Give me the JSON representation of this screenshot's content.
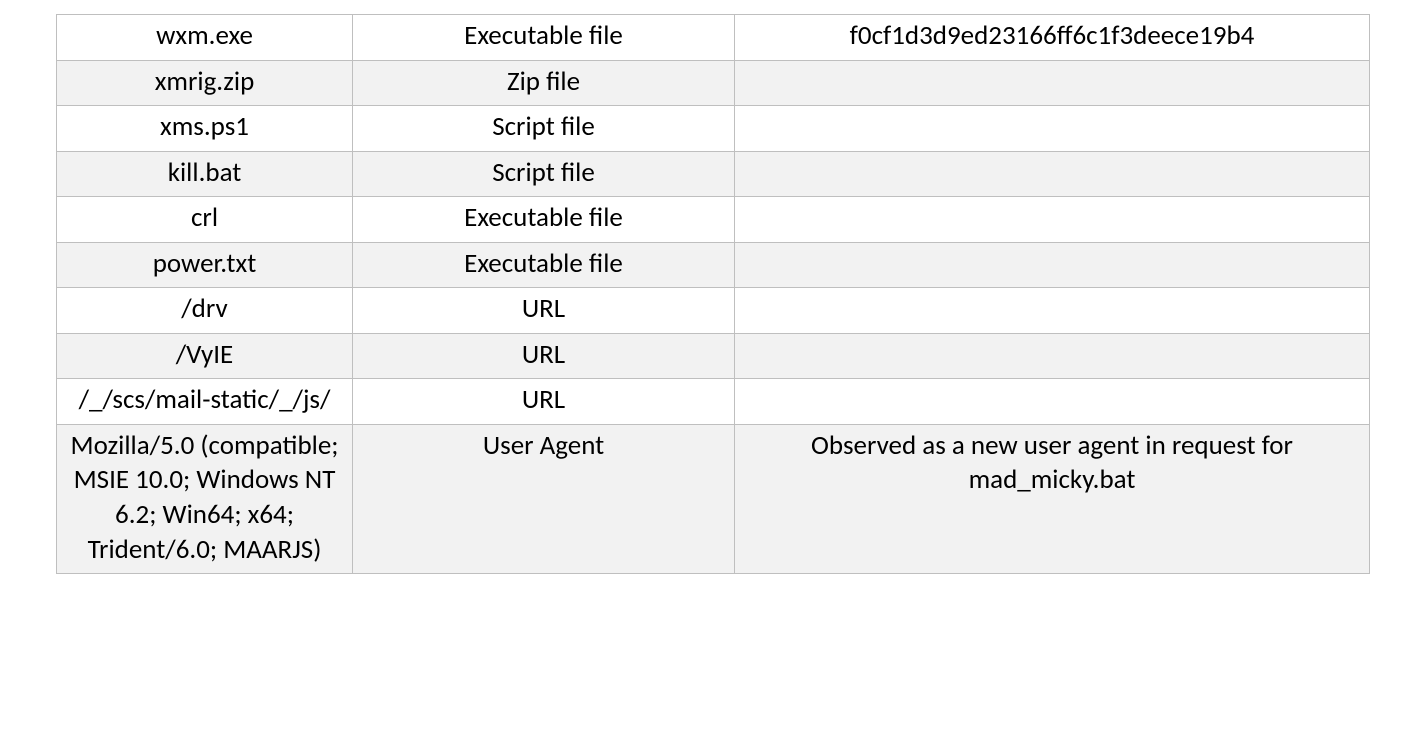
{
  "table": {
    "rows": [
      {
        "name": "wxm.exe",
        "type": "Executable file",
        "note": "f0cf1d3d9ed23166ff6c1f3deece19b4"
      },
      {
        "name": "xmrig.zip",
        "type": "Zip file",
        "note": ""
      },
      {
        "name": "xms.ps1",
        "type": "Script file",
        "note": ""
      },
      {
        "name": "kill.bat",
        "type": "Script file",
        "note": ""
      },
      {
        "name": "crl",
        "type": "Executable file",
        "note": ""
      },
      {
        "name": "power.txt",
        "type": "Executable file",
        "note": ""
      },
      {
        "name": "/drv",
        "type": "URL",
        "note": ""
      },
      {
        "name": "/VyIE",
        "type": "URL",
        "note": ""
      },
      {
        "name": "/_/scs/mail-static/_/js/",
        "type": "URL",
        "note": ""
      },
      {
        "name": "Mozilla/5.0 (compatible; MSIE 10.0; Windows NT 6.2; Win64; x64; Trident/6.0; MAARJS)",
        "type": "User Agent",
        "note": "Observed as a new user agent in request for mad_micky.bat"
      }
    ]
  }
}
